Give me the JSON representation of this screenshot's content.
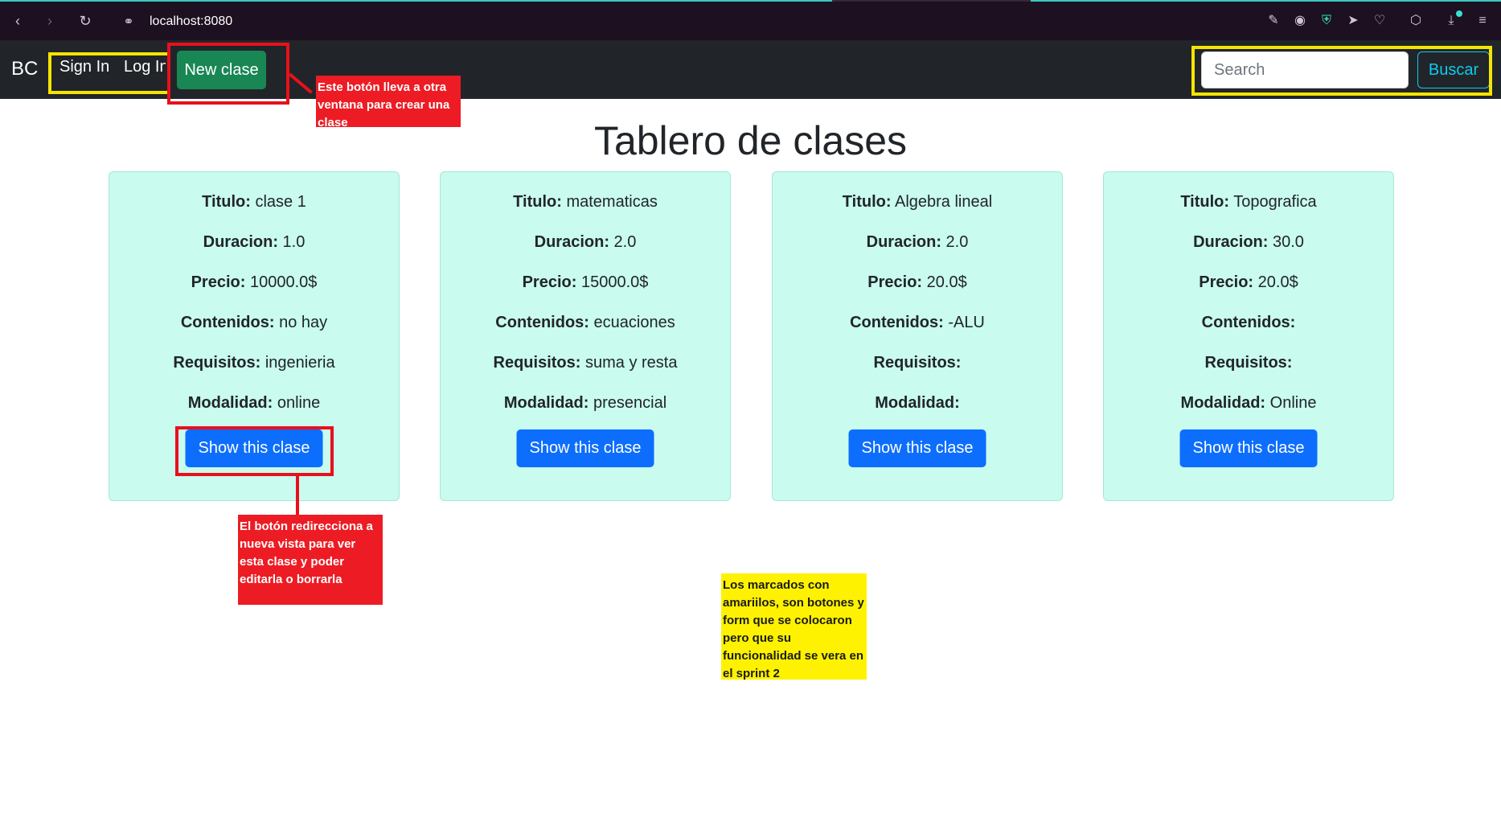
{
  "browser": {
    "url": "localhost:8080"
  },
  "navbar": {
    "brand": "BC",
    "sign_in": "Sign In",
    "log_in": "Log In",
    "new_clase": "New clase",
    "search_placeholder": "Search",
    "buscar": "Buscar"
  },
  "page_title": "Tablero de clases",
  "field_labels": {
    "titulo": "Titulo:",
    "duracion": "Duracion:",
    "precio": "Precio:",
    "contenidos": "Contenidos:",
    "requisitos": "Requisitos:",
    "modalidad": "Modalidad:"
  },
  "show_button_label": "Show this clase",
  "cards": [
    {
      "titulo": "clase 1",
      "duracion": "1.0",
      "precio": "10000.0$",
      "contenidos": "no hay",
      "requisitos": "ingenieria",
      "modalidad": "online"
    },
    {
      "titulo": "matematicas",
      "duracion": "2.0",
      "precio": "15000.0$",
      "contenidos": "ecuaciones",
      "requisitos": "suma y resta",
      "modalidad": "presencial"
    },
    {
      "titulo": "Algebra lineal",
      "duracion": "2.0",
      "precio": "20.0$",
      "contenidos": "-ALU",
      "requisitos": "",
      "modalidad": ""
    },
    {
      "titulo": "Topografica",
      "duracion": "30.0",
      "precio": "20.0$",
      "contenidos": "",
      "requisitos": "",
      "modalidad": "Online"
    }
  ],
  "annotations": {
    "new_clase_note": "Este botón lleva a otra ventana para crear una clase",
    "show_note": "El botón redirecciona a nueva vista para ver esta clase y poder editarla o borrarla",
    "yellow_note": "Los marcados con amariilos, son botones y form que se colocaron pero que su funcionalidad se vera en el sprint 2"
  },
  "colors": {
    "navbar_bg": "#212529",
    "new_button": "#198754",
    "show_button": "#0d6efd",
    "card_bg": "#c9fbef",
    "buscar_outline": "#0dcaf0",
    "highlight_yellow": "#f5e400",
    "highlight_red": "#e8101c"
  },
  "icons": {
    "back": "chevron-left-icon",
    "forward": "chevron-right-icon",
    "reload": "reload-icon",
    "site": "globe-icon"
  }
}
